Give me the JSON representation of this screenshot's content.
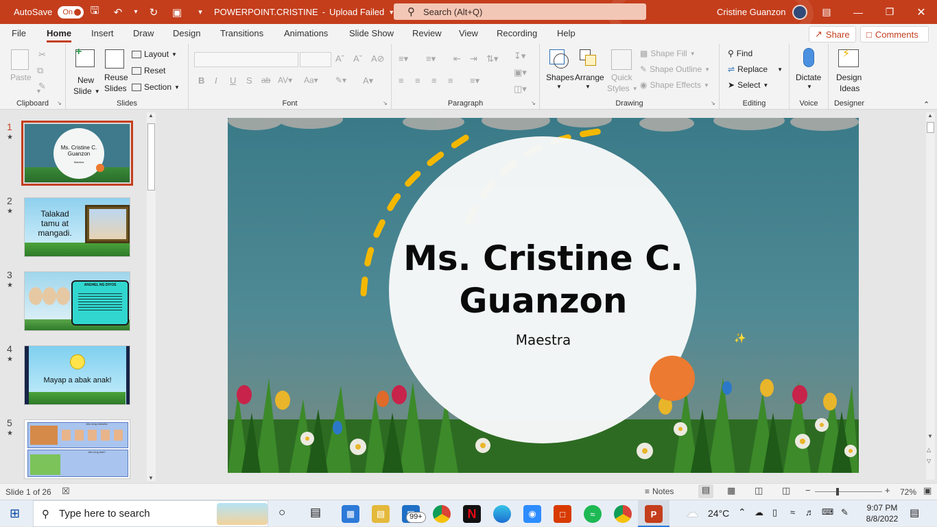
{
  "titlebar": {
    "autosave_label": "AutoSave",
    "autosave_state": "On",
    "doc_title": "POWERPOINT.CRISTINE",
    "upload_status": "Upload Failed",
    "search_placeholder": "Search (Alt+Q)",
    "user_name": "Cristine Guanzon"
  },
  "menu": {
    "tabs": [
      "File",
      "Home",
      "Insert",
      "Draw",
      "Design",
      "Transitions",
      "Animations",
      "Slide Show",
      "Review",
      "View",
      "Recording",
      "Help"
    ],
    "share": "Share",
    "comments": "Comments"
  },
  "ribbon": {
    "clipboard": {
      "paste": "Paste",
      "label": "Clipboard"
    },
    "slides": {
      "new_slide_1": "New",
      "new_slide_2": "Slide",
      "reuse_1": "Reuse",
      "reuse_2": "Slides",
      "layout": "Layout",
      "reset": "Reset",
      "section": "Section",
      "label": "Slides"
    },
    "font": {
      "label": "Font"
    },
    "paragraph": {
      "label": "Paragraph"
    },
    "drawing": {
      "shapes": "Shapes",
      "arrange": "Arrange",
      "quick_1": "Quick",
      "quick_2": "Styles",
      "shape_fill": "Shape Fill",
      "shape_outline": "Shape Outline",
      "shape_effects": "Shape Effects",
      "label": "Drawing"
    },
    "editing": {
      "find": "Find",
      "replace": "Replace",
      "select": "Select",
      "label": "Editing"
    },
    "voice": {
      "dictate": "Dictate",
      "label": "Voice"
    },
    "designer": {
      "ideas_1": "Design",
      "ideas_2": "Ideas",
      "label": "Designer"
    }
  },
  "thumbnails": [
    {
      "num": "1",
      "text1": "Ms. Cristine C.",
      "text2": "Guanzon",
      "text3": "Maestra"
    },
    {
      "num": "2",
      "text1": "Talakad",
      "text2": "tamu at",
      "text3": "mangadi."
    },
    {
      "num": "3",
      "text1": "ANGHEL NG DIYOS"
    },
    {
      "num": "4",
      "text1": "Mayap a abak anak!"
    },
    {
      "num": "5",
      "text1": "Atiu king eskwela",
      "text2": "Atiu king bale!"
    }
  ],
  "slide": {
    "title_line1": "Ms. Cristine C.",
    "title_line2": "Guanzon",
    "subtitle": "Maestra"
  },
  "status": {
    "slide_counter": "Slide 1 of 26",
    "notes": "Notes",
    "zoom": "72%"
  },
  "taskbar": {
    "search_placeholder": "Type here to search",
    "mail_badge": "99+",
    "temperature": "24°C",
    "time": "9:07 PM",
    "date": "8/8/2022"
  },
  "colors": {
    "accent": "#c43e1c",
    "slide_orange": "#ec7a30",
    "arc_yellow": "#f5b800"
  }
}
